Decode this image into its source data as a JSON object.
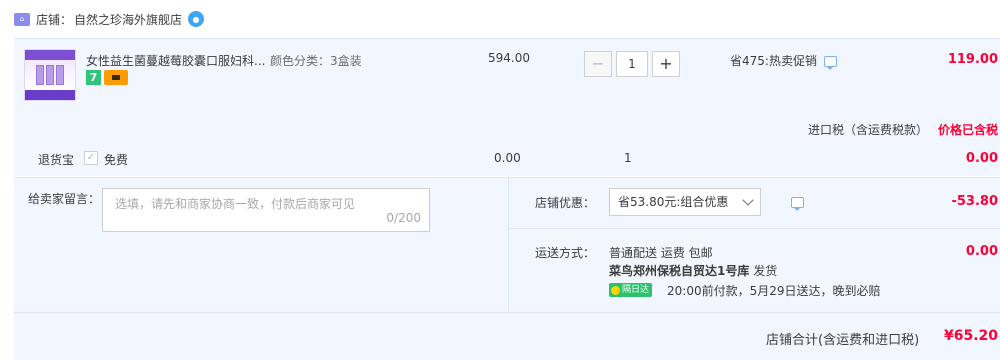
{
  "shop": {
    "label": "店铺：",
    "name": "自然之珍海外旗舰店"
  },
  "item": {
    "title": "女性益生菌蔓越莓胶囊口服妇科...",
    "spec": "颜色分类：3盒装",
    "unit_price": "594.00",
    "quantity": "1",
    "minus": "−",
    "plus": "+",
    "promo": "省475:热卖促销",
    "total": "119.00",
    "badge_number": "7"
  },
  "tax": {
    "label": "进口税（含运费税款）",
    "value": "价格已含税"
  },
  "return_insurance": {
    "label": "退货宝",
    "option": "免费",
    "price": "0.00",
    "quantity": "1",
    "total": "0.00",
    "check_mark": "✓"
  },
  "message": {
    "label": "给卖家留言：",
    "placeholder": "选填，请先和商家协商一致，付款后商家可见",
    "counter": "0/200"
  },
  "discount": {
    "label": "店铺优惠：",
    "selected": "省53.80元:组合优惠",
    "value": "-53.80"
  },
  "shipping": {
    "label": "运送方式：",
    "method": "普通配送 运费 包邮",
    "warehouse": "菜鸟郑州保税自贸达1号库",
    "dispatch": "发货",
    "badge": "隔日达",
    "eta": "20:00前付款，5月29日送达，晚到必赔",
    "value": "0.00"
  },
  "total": {
    "label": "店铺合计(含运费和进口税)",
    "value": "¥65.20"
  },
  "colors": {
    "accent_red": "#ff0036",
    "panel_bg": "#f2f7ff",
    "badge_green": "#2bc26b"
  }
}
